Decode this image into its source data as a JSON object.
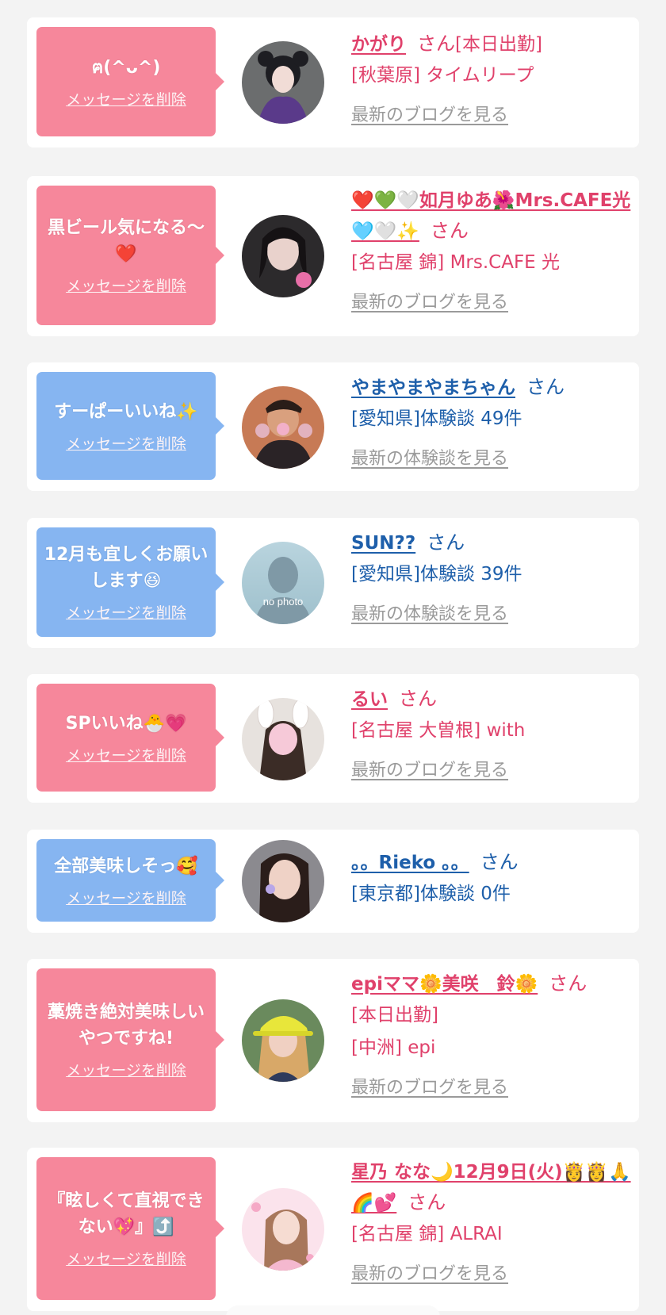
{
  "delete_label": "メッセージを削除",
  "san": "さん",
  "cards": [
    {
      "bubble_color": "#f6879b",
      "message": "ฅ(^ᴗ^)",
      "name": "かがり",
      "meta": [
        "[本日出勤]",
        "[秋葉原] タイムリープ"
      ],
      "link": "最新のブログを見る"
    },
    {
      "bubble_color": "#f6879b",
      "message": "黒ビール気になる〜❤️",
      "name": "❤️💚🤍如月ゆあ🌺Mrs.CAFE光🩵🤍✨",
      "meta": [
        "[名古屋 錦] Mrs.CAFE 光"
      ],
      "link": "最新のブログを見る"
    },
    {
      "bubble_color": "#86b5f1",
      "message": "すーぱーいいね✨",
      "name": "やまやまやまちゃん",
      "meta": [
        "[愛知県]体験談 49件"
      ],
      "link": "最新の体験談を見る"
    },
    {
      "bubble_color": "#86b5f1",
      "message": "12月も宜しくお願いします😆",
      "name": "SUN??",
      "meta": [
        "[愛知県]体験談 39件"
      ],
      "link": "最新の体験談を見る",
      "avatar_text": "no photo"
    },
    {
      "bubble_color": "#f6879b",
      "message": "SPいいね🐣💗",
      "name": "るい",
      "meta": [
        "[名古屋 大曽根] with"
      ],
      "link": "最新のブログを見る"
    },
    {
      "bubble_color": "#86b5f1",
      "message": "全部美味しそっ🥰",
      "name": "。。Rieko 。。",
      "meta": [
        "[東京都]体験談 0件"
      ],
      "link": ""
    },
    {
      "bubble_color": "#f6879b",
      "message": "藁焼き絶対美味しいやつですね!",
      "name": "epiママ🌼美咲　鈴🌼",
      "meta": [
        "[本日出勤]",
        "[中洲] epi"
      ],
      "link": "最新のブログを見る"
    },
    {
      "bubble_color": "#f6879b",
      "message": "『眩しくて直視できない💖』⤴️",
      "name": "星乃 なな🌙12月9日(火)👸👸🙏🌈💕",
      "meta": [
        "[名古屋 錦] ALRAI"
      ],
      "link": "最新のブログを見る"
    }
  ]
}
